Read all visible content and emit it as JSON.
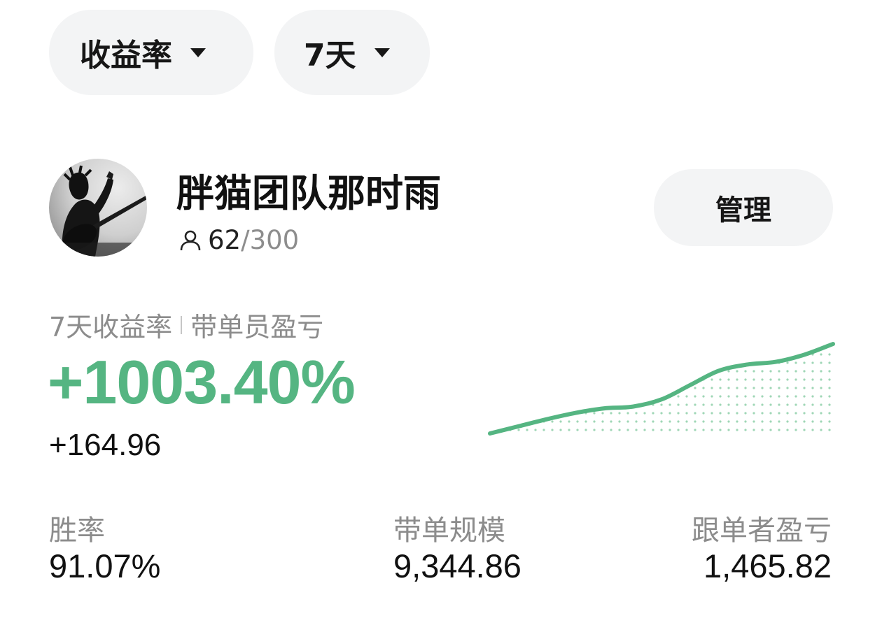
{
  "filters": {
    "metric": {
      "label": "收益率",
      "icon": "caret-down-icon"
    },
    "period": {
      "label": "7天",
      "icon": "caret-down-icon"
    }
  },
  "team": {
    "name": "胖猫团队那时雨",
    "members_current": "62",
    "members_separator": "/",
    "members_max": "300",
    "members_icon": "person-icon",
    "manage_label": "管理"
  },
  "performance": {
    "label_period": "7天收益率",
    "label_switch": "带单员盈亏",
    "return_rate": "+1003.40%",
    "pnl": "+164.96",
    "accent_color": "#55b582"
  },
  "chart_data": {
    "type": "area",
    "x": [
      0,
      1,
      2,
      3,
      4,
      5,
      6,
      7,
      8,
      9,
      10,
      11,
      12
    ],
    "values": [
      0.0,
      0.08,
      0.16,
      0.23,
      0.28,
      0.3,
      0.38,
      0.54,
      0.7,
      0.77,
      0.8,
      0.88,
      1.0
    ],
    "title": "",
    "xlabel": "",
    "ylabel": "",
    "ylim": [
      0,
      1
    ],
    "grid": false,
    "legend": "none",
    "color": "#55b582"
  },
  "stats": [
    {
      "label": "胜率",
      "value": "91.07%"
    },
    {
      "label": "带单规模",
      "value": "9,344.86"
    },
    {
      "label": "跟单者盈亏",
      "value": "1,465.82"
    }
  ]
}
